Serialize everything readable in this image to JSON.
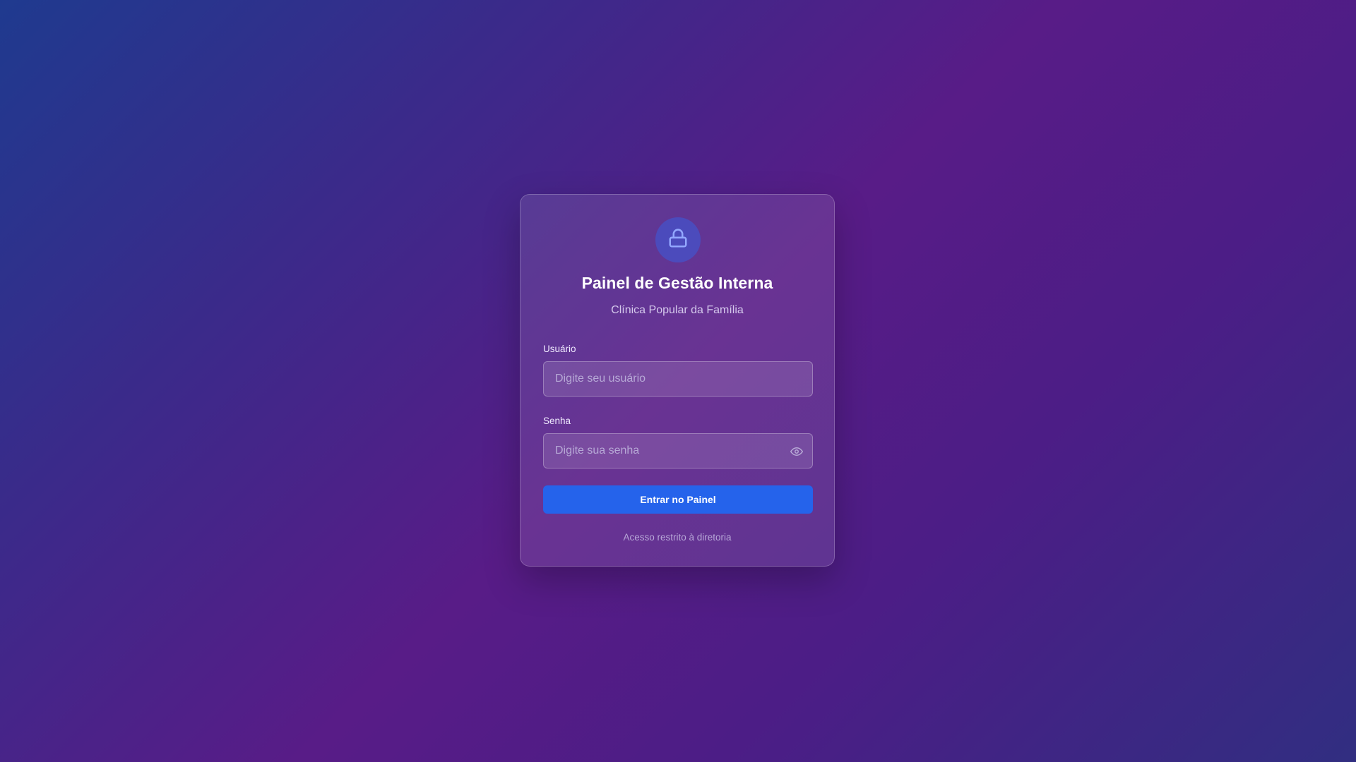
{
  "login_card": {
    "lock_icon": "lock-icon",
    "title": "Painel de Gestão Interna",
    "subtitle": "Clínica Popular da Família",
    "username": {
      "label": "Usuário",
      "value": "",
      "placeholder": "Digite seu usuário"
    },
    "password": {
      "label": "Senha",
      "value": "",
      "placeholder": "Digite sua senha",
      "toggle_icon": "eye-icon"
    },
    "submit_label": "Entrar no Painel",
    "footnote": "Acesso restrito à diretoria"
  },
  "colors": {
    "accent": "#2563eb",
    "lock_icon": "#93a7ff",
    "background_start": "#1f3a8f",
    "background_mid": "#581c87",
    "background_end": "#312e81"
  }
}
